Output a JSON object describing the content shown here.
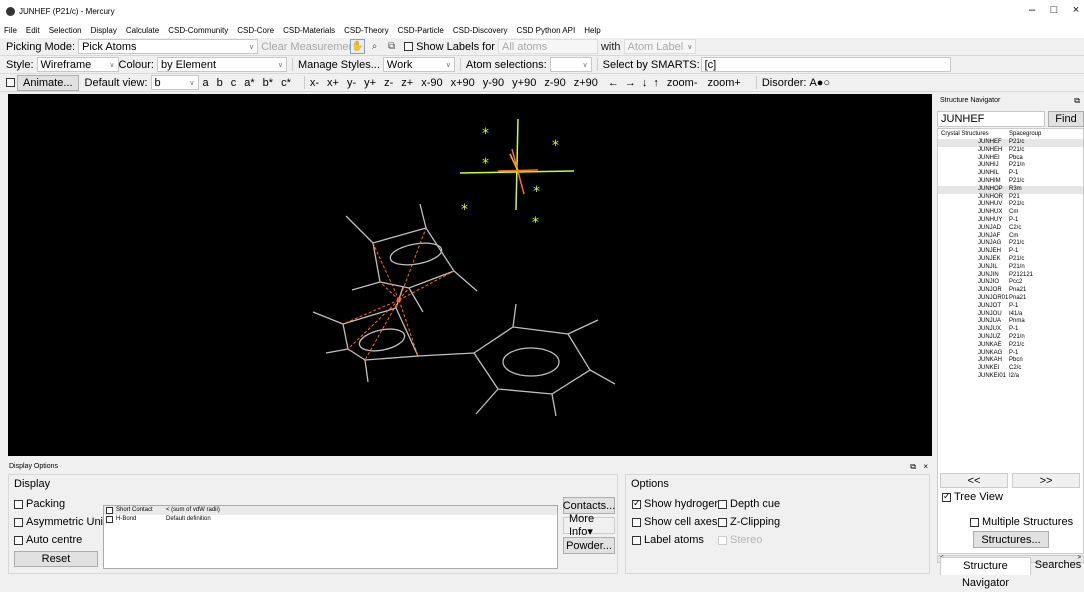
{
  "window": {
    "title": "JUNHEF (P21/c) - Mercury"
  },
  "menu": [
    "File",
    "Edit",
    "Selection",
    "Display",
    "Calculate",
    "CSD-Community",
    "CSD-Core",
    "CSD-Materials",
    "CSD-Theory",
    "CSD-Particle",
    "CSD-Discovery",
    "CSD Python API",
    "Help"
  ],
  "toolbar1": {
    "picking_label": "Picking Mode:",
    "picking_value": "Pick Atoms",
    "clear_label": "Clear Measurements",
    "show_labels": "Show Labels for",
    "labels_for_value": "All atoms",
    "with_label": "with",
    "with_value": "Atom Label"
  },
  "toolbar2": {
    "style_label": "Style:",
    "style_value": "Wireframe",
    "colour_label": "Colour:",
    "colour_value": "by Element",
    "manage_styles": "Manage Styles...",
    "work_value": "Work",
    "atom_sel_label": "Atom selections:",
    "smarts_label": "Select by SMARTS:",
    "smarts_value": "[c]"
  },
  "toolbar3": {
    "animate": "Animate...",
    "default_view_label": "Default view:",
    "default_view_value": "b",
    "views": [
      "a",
      "b",
      "c",
      "a*",
      "b*",
      "c*"
    ],
    "rotations": [
      "x-",
      "x+",
      "y-",
      "y+",
      "z-",
      "z+",
      "x-90",
      "x+90",
      "y-90",
      "y+90",
      "z-90",
      "z+90"
    ],
    "arrows": [
      "←",
      "→",
      "↓",
      "↑"
    ],
    "zoom": [
      "zoom-",
      "zoom+"
    ],
    "disorder_label": "Disorder:",
    "disorder_value": "A●○"
  },
  "navigator": {
    "title": "Structure Navigator",
    "search_value": "JUNHEF",
    "find_label": "Find",
    "col_structures": "Crystal Structures",
    "col_spacegroup": "Spacegroup",
    "rows": [
      {
        "id": "JUNHEF",
        "sg": "P21/c",
        "hl": true
      },
      {
        "id": "JUNHEH",
        "sg": "P21/c"
      },
      {
        "id": "JUNHEI",
        "sg": "Pbca"
      },
      {
        "id": "JUNHIJ",
        "sg": "P21/n"
      },
      {
        "id": "JUNHIL",
        "sg": "P-1"
      },
      {
        "id": "JUNHIM",
        "sg": "P21/c"
      },
      {
        "id": "JUNHOP",
        "sg": "R3m",
        "hl": true
      },
      {
        "id": "JUNHOR",
        "sg": "P21"
      },
      {
        "id": "JUNHUV",
        "sg": "P21/c"
      },
      {
        "id": "JUNHUX",
        "sg": "Cm"
      },
      {
        "id": "JUNHUY",
        "sg": "P-1"
      },
      {
        "id": "JUNJAD",
        "sg": "C2/c"
      },
      {
        "id": "JUNJAF",
        "sg": "Cm"
      },
      {
        "id": "JUNJAG",
        "sg": "P21/c"
      },
      {
        "id": "JUNJEH",
        "sg": "P-1"
      },
      {
        "id": "JUNJEK",
        "sg": "P21/c"
      },
      {
        "id": "JUNJIL",
        "sg": "P21/n"
      },
      {
        "id": "JUNJIN",
        "sg": "P212121"
      },
      {
        "id": "JUNJIO",
        "sg": "Pcc2"
      },
      {
        "id": "JUNJOR",
        "sg": "Pna21"
      },
      {
        "id": "JUNJOR01",
        "sg": "Pna21"
      },
      {
        "id": "JUNJOT",
        "sg": "P-1"
      },
      {
        "id": "JUNJOU",
        "sg": "I41/a"
      },
      {
        "id": "JUNJUA",
        "sg": "Pnma"
      },
      {
        "id": "JUNJUX",
        "sg": "P-1"
      },
      {
        "id": "JUNJUZ",
        "sg": "P21/n"
      },
      {
        "id": "JUNKAE",
        "sg": "P21/c"
      },
      {
        "id": "JUNKAG",
        "sg": "P-1"
      },
      {
        "id": "JUNKAH",
        "sg": "Pbcn"
      },
      {
        "id": "JUNKEI",
        "sg": "C2/c"
      },
      {
        "id": "JUNKEI01",
        "sg": "I2/a"
      }
    ],
    "prev": "<<",
    "next": ">>",
    "tree_view": "Tree View",
    "multiple_structures": "Multiple Structures",
    "structures_btn": "Structures...",
    "tab_navigator": "Structure Navigator",
    "tab_searches": "Searches"
  },
  "display_options": {
    "title": "Display Options",
    "display_group": "Display",
    "packing": "Packing",
    "asym_unit": "Asymmetric Unit",
    "auto_centre": "Auto centre",
    "reset": "Reset",
    "contacts": [
      {
        "name": "Short Contact",
        "desc": "< (sum of vdW radii)"
      },
      {
        "name": "H-Bond",
        "desc": "Default definition"
      }
    ],
    "contacts_btn": "Contacts...",
    "more_info_btn": "More Info▾",
    "powder_btn": "Powder...",
    "options_group": "Options",
    "show_hydrogens": "Show hydrogens",
    "depth_cue": "Depth cue",
    "show_cell_axes": "Show cell axes",
    "z_clipping": "Z-Clipping",
    "label_atoms": "Label atoms",
    "stereo": "Stereo"
  },
  "colors": {
    "viewer_bg": "#000000",
    "bond": "#bfbfbf",
    "fe_bond": "#ff6a1a",
    "cl": "#c8ff1e"
  }
}
